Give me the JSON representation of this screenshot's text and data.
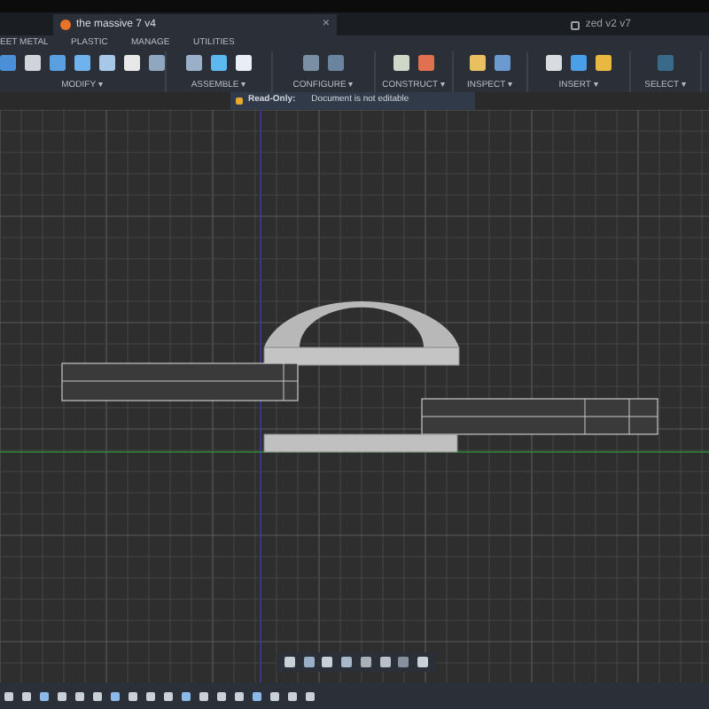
{
  "document_tabs": [
    {
      "title": "the massive 7 v4",
      "selected": true
    },
    {
      "title": "zed v2 v7",
      "selected": false
    }
  ],
  "ribbon_tabs": [
    "EET METAL",
    "PLASTIC",
    "MANAGE",
    "UTILITIES"
  ],
  "tool_groups": [
    {
      "label": "MODIFY",
      "caret": "▾"
    },
    {
      "label": "ASSEMBLE",
      "caret": "▾"
    },
    {
      "label": "CONFIGURE",
      "caret": "▾"
    },
    {
      "label": "CONSTRUCT",
      "caret": "▾"
    },
    {
      "label": "INSPECT",
      "caret": "▾"
    },
    {
      "label": "INSERT",
      "caret": "▾"
    },
    {
      "label": "SELECT",
      "caret": "▾"
    }
  ],
  "notice": {
    "label": "Read-Only:",
    "message": "Document is not editable"
  },
  "close_glyph": "×"
}
